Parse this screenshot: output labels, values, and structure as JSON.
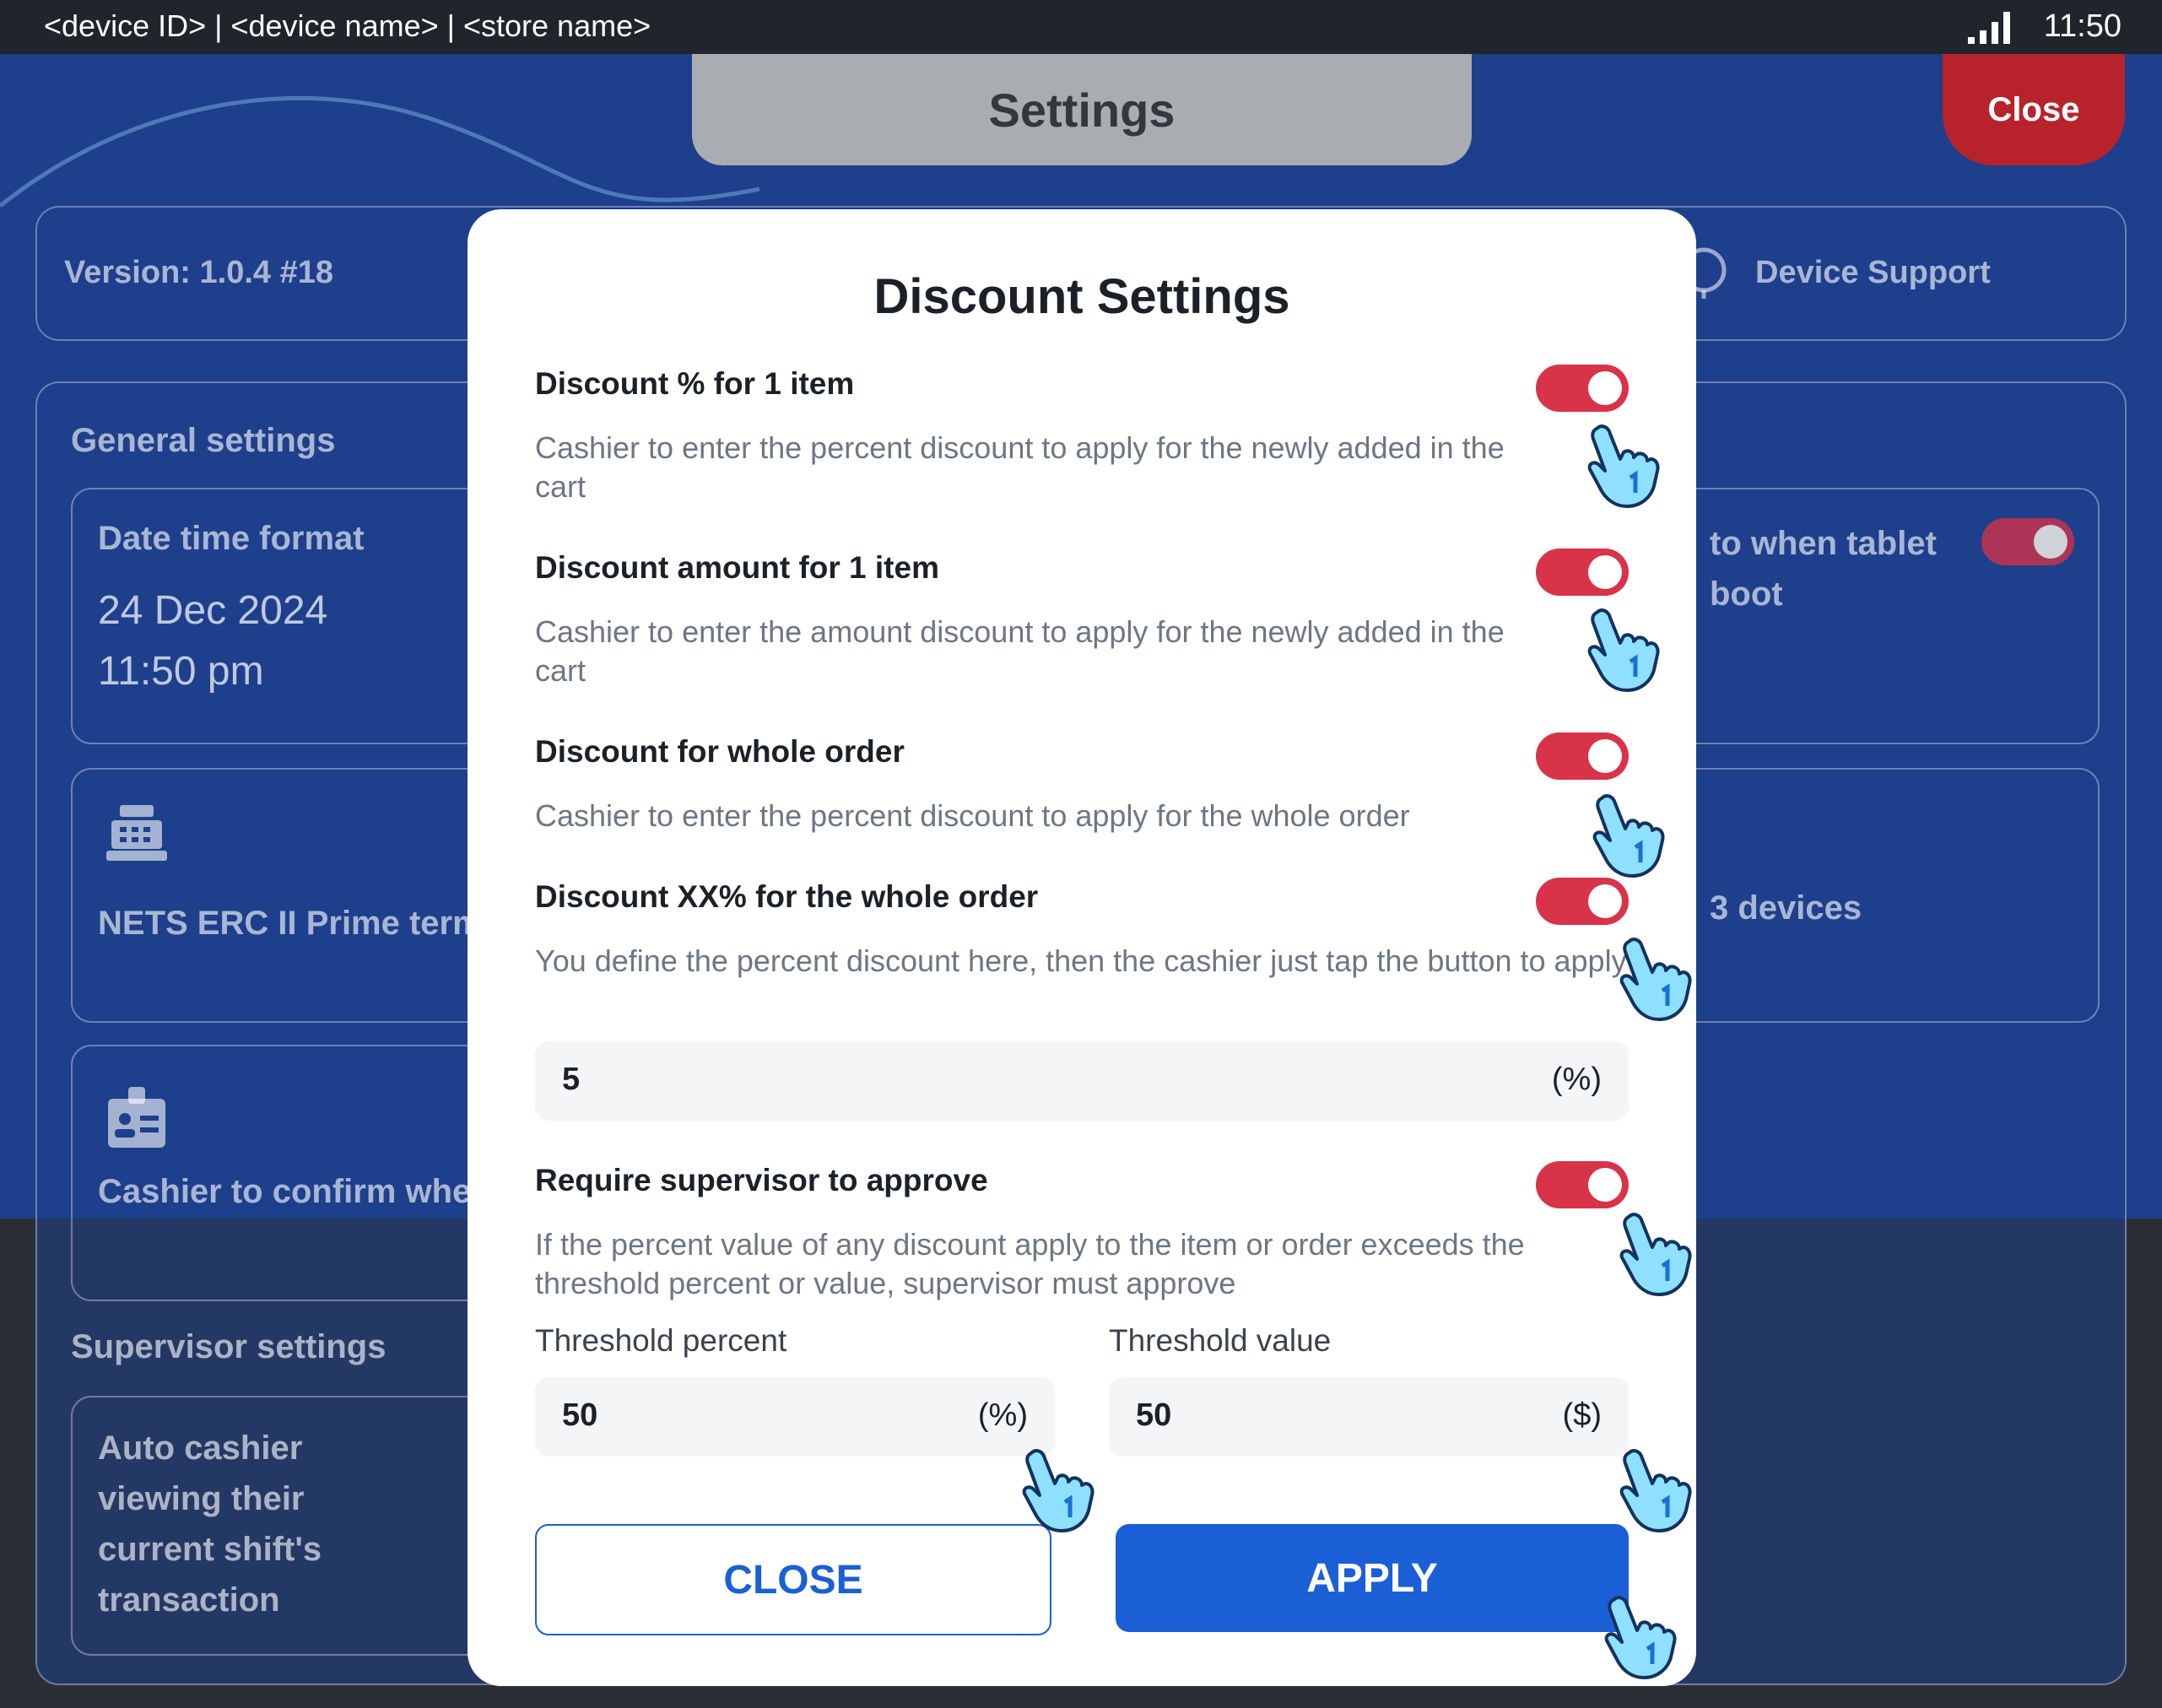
{
  "status_bar": {
    "device_info": "<device ID> | <device name> | <store name>",
    "time": "11:50",
    "signal_icon": "signal-bars-icon"
  },
  "header": {
    "title": "Settings",
    "close_label": "Close"
  },
  "version_bar": {
    "version": "Version:  1.0.4 #18",
    "device_support": "Device Support"
  },
  "general": {
    "title": "General settings",
    "date_time_format": {
      "title": "Date time format",
      "date": "24 Dec 2024",
      "time": "11:50 pm"
    },
    "terminal": {
      "label": "NETS ERC II Prime terminal"
    },
    "user_card": {
      "label": "Cashier to confirm when pay with user card"
    },
    "right_card_1": {
      "label": "to when tablet boot"
    },
    "right_card_2": {
      "label": "3 devices"
    }
  },
  "supervisor": {
    "title": "Supervisor settings",
    "auto_cashier": {
      "label": "Auto cashier viewing their current shift's transaction"
    }
  },
  "modal": {
    "title": "Discount Settings",
    "options": [
      {
        "title": "Discount % for 1 item",
        "desc": "Cashier to enter the percent discount to apply for the newly added in the cart",
        "on": true
      },
      {
        "title": "Discount amount for 1 item",
        "desc": "Cashier to enter the amount discount to apply for the newly added in the cart",
        "on": true
      },
      {
        "title": "Discount for whole order",
        "desc": "Cashier to enter the percent discount to apply for the whole order",
        "on": true
      },
      {
        "title": "Discount XX% for the whole order",
        "desc": "You define the percent discount here, then the cashier just tap the button to apply",
        "on": true
      },
      {
        "title": "Require supervisor to approve",
        "desc": "If the percent value of any discount apply to the item or order exceeds the threshold percent or value, supervisor must approve",
        "on": true
      }
    ],
    "percent_input": {
      "value": "5",
      "unit": "(%)"
    },
    "threshold_percent": {
      "label": "Threshold percent",
      "value": "50",
      "unit": "(%)"
    },
    "threshold_value": {
      "label": "Threshold value",
      "value": "50",
      "unit": "($)"
    },
    "close_button": "CLOSE",
    "apply_button": "APPLY"
  },
  "colors": {
    "page_blue": "#1e3f8c",
    "toggle_on": "#d83348",
    "primary": "#1b5fd6",
    "close_red": "#b8222b"
  },
  "icons": [
    "tap-hand-icon",
    "cash-register-icon",
    "id-badge-icon",
    "support-icon"
  ]
}
